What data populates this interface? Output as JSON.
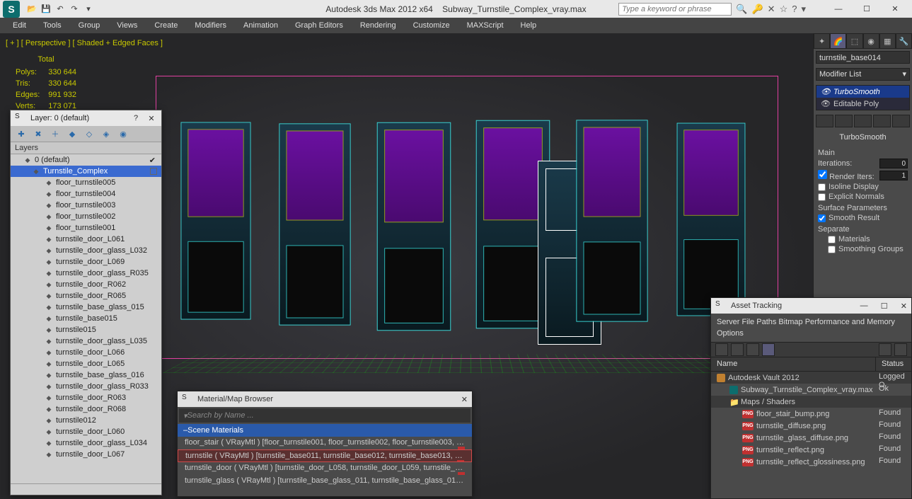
{
  "titlebar": {
    "app_title": "Autodesk 3ds Max  2012 x64",
    "file_name": "Subway_Turnstile_Complex_vray.max",
    "search_placeholder": "Type a keyword or phrase"
  },
  "menubar": [
    "Edit",
    "Tools",
    "Group",
    "Views",
    "Create",
    "Modifiers",
    "Animation",
    "Graph Editors",
    "Rendering",
    "Customize",
    "MAXScript",
    "Help"
  ],
  "viewport": {
    "label": "[ + ]  [ Perspective ]  [ Shaded + Edged Faces ]",
    "stats_title": "Total",
    "stats": [
      {
        "k": "Polys:",
        "v": "330 644"
      },
      {
        "k": "Tris:",
        "v": "330 644"
      },
      {
        "k": "Edges:",
        "v": "991 932"
      },
      {
        "k": "Verts:",
        "v": "173 071"
      }
    ]
  },
  "cmdpanel": {
    "obj_name": "turnstile_base014",
    "modifier_list": "Modifier List",
    "modstack": [
      {
        "name": "TurboSmooth",
        "sel": true
      },
      {
        "name": "Editable Poly",
        "sel": false
      }
    ],
    "rollout_title": "TurboSmooth",
    "main_label": "Main",
    "iterations_label": "Iterations:",
    "iterations_val": "0",
    "render_iters_label": "Render Iters:",
    "render_iters_val": "1",
    "isoline_label": "Isoline Display",
    "explicit_label": "Explicit Normals",
    "surface_label": "Surface Parameters",
    "smooth_result_label": "Smooth Result",
    "separate_label": "Separate",
    "sep_materials": "Materials",
    "sep_smoothing": "Smoothing Groups"
  },
  "layer_panel": {
    "title": "Layer: 0 (default)",
    "header": "Layers",
    "rows": [
      {
        "t": "0 (default)",
        "ind": 0,
        "check": true
      },
      {
        "t": "Turnstile_Complex",
        "ind": 1,
        "sel": true,
        "box": true
      },
      {
        "t": "floor_turnstile005",
        "ind": 2
      },
      {
        "t": "floor_turnstile004",
        "ind": 2
      },
      {
        "t": "floor_turnstile003",
        "ind": 2
      },
      {
        "t": "floor_turnstile002",
        "ind": 2
      },
      {
        "t": "floor_turnstile001",
        "ind": 2
      },
      {
        "t": "turnstile_door_L061",
        "ind": 2
      },
      {
        "t": "turnstile_door_glass_L032",
        "ind": 2
      },
      {
        "t": "turnstile_door_L069",
        "ind": 2
      },
      {
        "t": "turnstile_door_glass_R035",
        "ind": 2
      },
      {
        "t": "turnstile_door_R062",
        "ind": 2
      },
      {
        "t": "turnstile_door_R065",
        "ind": 2
      },
      {
        "t": "turnstile_base_glass_015",
        "ind": 2
      },
      {
        "t": "turnstile_base015",
        "ind": 2
      },
      {
        "t": "turnstile015",
        "ind": 2
      },
      {
        "t": "turnstile_door_glass_L035",
        "ind": 2
      },
      {
        "t": "turnstile_door_L066",
        "ind": 2
      },
      {
        "t": "turnstile_door_L065",
        "ind": 2
      },
      {
        "t": "turnstile_base_glass_016",
        "ind": 2
      },
      {
        "t": "turnstile_door_glass_R033",
        "ind": 2
      },
      {
        "t": "turnstile_door_R063",
        "ind": 2
      },
      {
        "t": "turnstile_door_R068",
        "ind": 2
      },
      {
        "t": "turnstile012",
        "ind": 2
      },
      {
        "t": "turnstile_door_L060",
        "ind": 2
      },
      {
        "t": "turnstile_door_glass_L034",
        "ind": 2
      },
      {
        "t": "turnstile_door_L067",
        "ind": 2
      }
    ]
  },
  "mat_panel": {
    "title": "Material/Map Browser",
    "search": "Search by Name ...",
    "group": "Scene Materials",
    "rows": [
      {
        "t": "floor_stair ( VRayMtl ) [floor_turnstile001, floor_turnstile002, floor_turnstile003, floor_...",
        "badge": true
      },
      {
        "t": "turnstile ( VRayMtl ) [turnstile_base011, turnstile_base012, turnstile_base013, turnstil...",
        "sel": true,
        "badge": true
      },
      {
        "t": "turnstile_door ( VRayMtl ) [turnstile_door_L058, turnstile_door_L059, turnstile_door_L...",
        "badge": true
      },
      {
        "t": "turnstile_glass ( VRayMtl ) [turnstile_base_glass_011, turnstile_base_glass_012, turnst..."
      }
    ]
  },
  "asset_panel": {
    "title": "Asset Tracking",
    "menu": "Server    File    Paths    Bitmap Performance and Memory Options",
    "col_name": "Name",
    "col_status": "Status",
    "rows": [
      {
        "t": "Autodesk Vault 2012",
        "s": "Logged O",
        "ind": 0,
        "ic": "vault",
        "group": true
      },
      {
        "t": "Subway_Turnstile_Complex_vray.max",
        "s": "Ok",
        "ind": 1,
        "ic": "max"
      },
      {
        "t": "Maps / Shaders",
        "s": "",
        "ind": 1,
        "ic": "folder",
        "group": true
      },
      {
        "t": "floor_stair_bump.png",
        "s": "Found",
        "ind": 2,
        "ic": "png"
      },
      {
        "t": "turnstile_diffuse.png",
        "s": "Found",
        "ind": 2,
        "ic": "png"
      },
      {
        "t": "turnstile_glass_diffuse.png",
        "s": "Found",
        "ind": 2,
        "ic": "png"
      },
      {
        "t": "turnstile_reflect.png",
        "s": "Found",
        "ind": 2,
        "ic": "png"
      },
      {
        "t": "turnstile_reflect_glossiness.png",
        "s": "Found",
        "ind": 2,
        "ic": "png"
      }
    ]
  }
}
